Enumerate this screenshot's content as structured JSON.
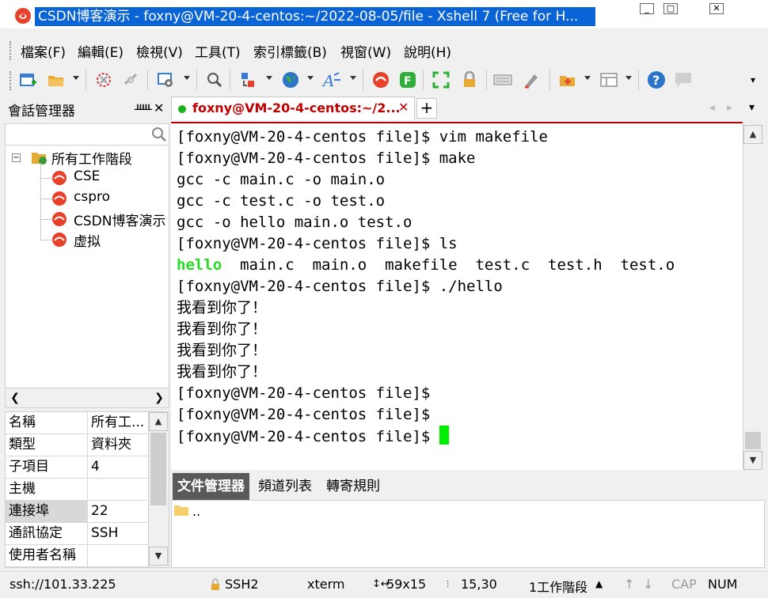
{
  "window": {
    "title": "CSDN博客演示 - foxny@VM-20-4-centos:~/2022-08-05/file - Xshell 7 (Free for H...",
    "controls": {
      "minimize": "_",
      "maximize": "□",
      "close": "✕"
    }
  },
  "menu": [
    "檔案(F)",
    "編輯(E)",
    "檢視(V)",
    "工具(T)",
    "索引標籤(B)",
    "視窗(W)",
    "說明(H)"
  ],
  "session_manager": {
    "title": "會話管理器",
    "pin": "ᚊ",
    "close": "✕",
    "tree_root": "所有工作階段",
    "tree_items": [
      "CSE",
      "cspro",
      "CSDN博客演示",
      "虚拟"
    ]
  },
  "properties": [
    {
      "key": "名稱",
      "value": "所有工..."
    },
    {
      "key": "類型",
      "value": "資料夾"
    },
    {
      "key": "子項目",
      "value": "4"
    },
    {
      "key": "主機",
      "value": ""
    },
    {
      "key": "連接埠",
      "value": "22"
    },
    {
      "key": "通訊協定",
      "value": "SSH"
    },
    {
      "key": "使用者名稱",
      "value": ""
    }
  ],
  "terminal_tab": {
    "label": "foxny@VM-20-4-centos:~/2...",
    "close": "✕",
    "add": "+"
  },
  "terminal": {
    "lines": [
      "[foxny@VM-20-4-centos file]$ vim makefile",
      "[foxny@VM-20-4-centos file]$ make",
      "gcc -c main.c -o main.o",
      "gcc -c test.c -o test.o",
      "gcc -o hello main.o test.o",
      "[foxny@VM-20-4-centos file]$ ls"
    ],
    "ls_exec": "hello",
    "ls_rest": "  main.c  main.o  makefile  test.c  test.h  test.o",
    "run_line": "[foxny@VM-20-4-centos file]$ ./hello",
    "output_lines": [
      "我看到你了！",
      "我看到你了！",
      "我看到你了！",
      "我看到你了！"
    ],
    "prompt_lines": [
      "[foxny@VM-20-4-centos file]$",
      "[foxny@VM-20-4-centos file]$",
      "[foxny@VM-20-4-centos file]$ "
    ]
  },
  "bottom_tabs": [
    "文件管理器",
    "頻道列表",
    "轉寄規則"
  ],
  "file_list": [
    ".."
  ],
  "status": {
    "address": "ssh://101.33.225",
    "protocol": "SSH2",
    "term": "xterm",
    "size": "59x15",
    "pos": "15,30",
    "sessions": "1工作階段",
    "cap": "CAP",
    "num": "NUM"
  },
  "colors": {
    "title_highlight": "#0a64d6",
    "tab_text": "#c00000",
    "exec_green": "#22dd22",
    "cursor": "#00ee00"
  }
}
